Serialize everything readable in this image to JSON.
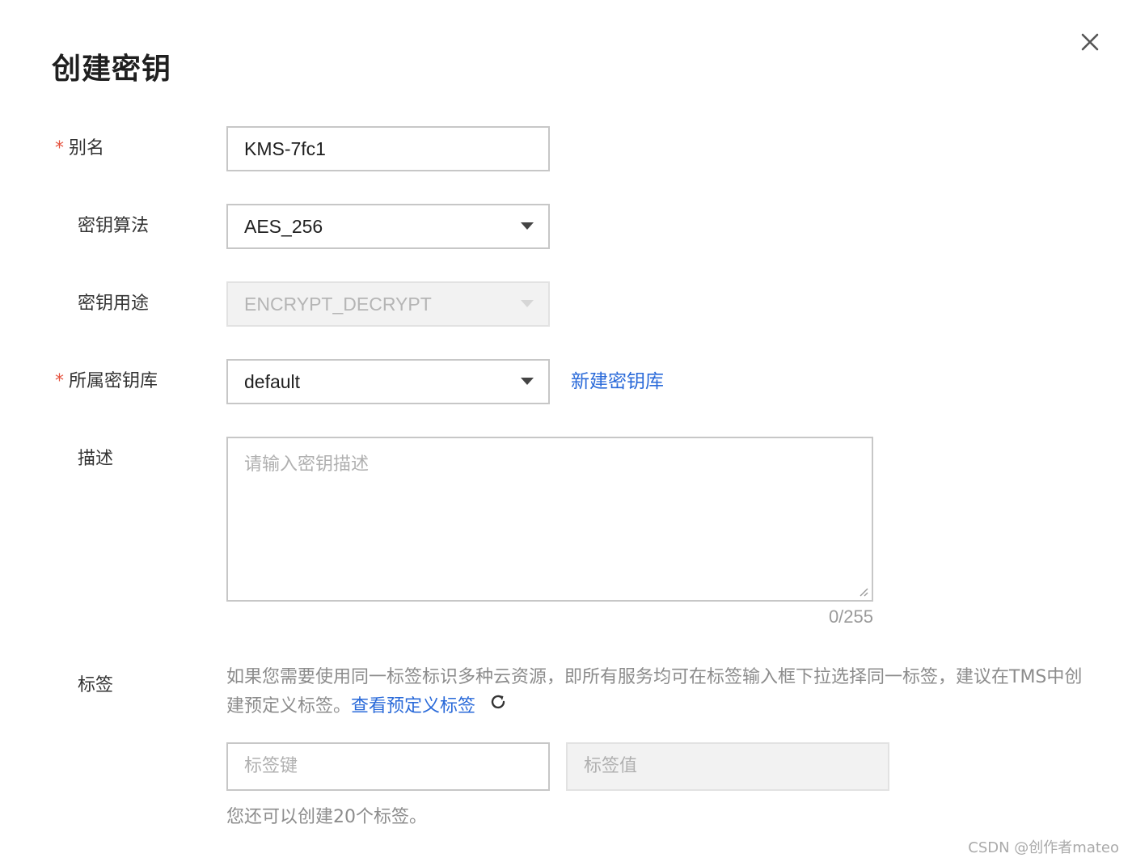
{
  "dialog": {
    "title": "创建密钥"
  },
  "form": {
    "alias": {
      "label": "别名",
      "required": true,
      "value": "KMS-7fc1"
    },
    "algorithm": {
      "label": "密钥算法",
      "value": "AES_256"
    },
    "usage": {
      "label": "密钥用途",
      "value": "ENCRYPT_DECRYPT",
      "disabled": true
    },
    "keystore": {
      "label": "所属密钥库",
      "required": true,
      "value": "default",
      "create_link": "新建密钥库"
    },
    "description": {
      "label": "描述",
      "placeholder": "请输入密钥描述",
      "counter": "0/255"
    },
    "tags": {
      "label": "标签",
      "hint_text": "如果您需要使用同一标签标识多种云资源，即所有服务均可在标签输入框下拉选择同一标签，建议在TMS中创建预定义标签。",
      "hint_link": "查看预定义标签",
      "key_placeholder": "标签键",
      "value_placeholder": "标签值",
      "remaining_text": "您还可以创建20个标签。"
    }
  },
  "required_mark": "*",
  "watermark": "CSDN @创作者mateo",
  "colors": {
    "required": "#e5533f",
    "link": "#2a6ad9",
    "border": "#c7c7c7",
    "disabled_bg": "#f2f2f2"
  },
  "icons": {
    "close": "close-icon",
    "dropdown": "caret-down-icon",
    "refresh": "refresh-icon"
  }
}
